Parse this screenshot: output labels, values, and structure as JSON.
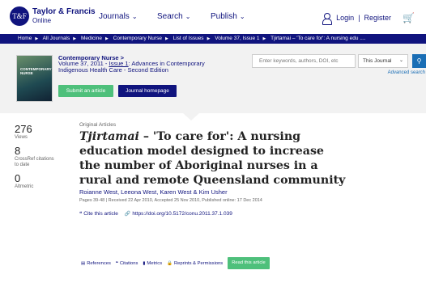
{
  "header": {
    "logo_line1": "Taylor & Francis",
    "logo_line2": "Online",
    "logo_mark": "T&F",
    "nav": [
      "Journals",
      "Search",
      "Publish"
    ],
    "login": "Login",
    "separator": "|",
    "register": "Register"
  },
  "breadcrumb": [
    "Home",
    "All Journals",
    "Medicine",
    "Contemporary Nurse",
    "List of Issues",
    "Volume 37, Issue 1",
    "Tjirtamai – 'To care for': A nursing edu ...."
  ],
  "journal": {
    "title": "Contemporary Nurse >",
    "volume_prefix": "Volume 37, 2011 - ",
    "issue_link": "Issue 1",
    "issue_suffix": ": Advances in Contemporary Indigenous Health Care - Second Edition",
    "cover_text": "CONTEMPORARY NURSE",
    "submit_label": "Submit an article",
    "homepage_label": "Journal homepage"
  },
  "search": {
    "placeholder": "Enter keywords, authors, DOI, etc",
    "scope": "This Journal",
    "advanced": "Advanced search"
  },
  "stats": {
    "views_count": "276",
    "views_label": "Views",
    "crossref_count": "8",
    "crossref_label": "CrossRef citations to date",
    "altmetric_count": "0",
    "altmetric_label": "Altmetric"
  },
  "article": {
    "type": "Original Articles",
    "title_italic": "Tjirtamai",
    "title_rest": " – 'To care for': A nursing education model designed to increase the number of Aboriginal nurses in a rural and remote Queensland community",
    "authors": "Roianne West, Leeona West, Karen West & Kim Usher",
    "dates": "Pages 39-48 | Received 22 Apr 2010, Accepted 25 Nov 2010, Published online: 17 Dec 2014",
    "cite_label": "Cite this article",
    "doi": "https://doi.org/10.5172/conu.2011.37.1.039"
  },
  "tabs": {
    "references": "References",
    "citations": "Citations",
    "metrics": "Metrics",
    "reprints": "Reprints & Permissions",
    "read": "Read this article"
  }
}
